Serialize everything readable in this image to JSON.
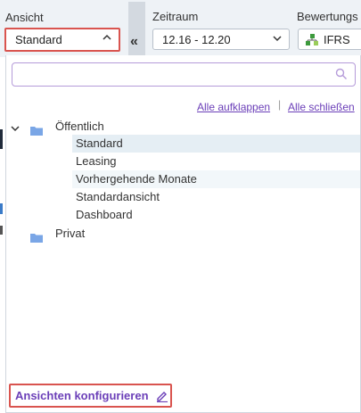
{
  "toolbar": {
    "ansicht_label": "Ansicht",
    "ansicht_value": "Standard",
    "zeitraum_label": "Zeitraum",
    "zeitraum_value": "12.16 - 12.20",
    "bewertung_label": "Bewertungs",
    "bewertung_value": "IFRS",
    "collapse_glyph": "«"
  },
  "panel": {
    "search_placeholder": "",
    "expand_all": "Alle aufklappen",
    "link_separator": "|",
    "collapse_all": "Alle schließen",
    "groups": [
      {
        "label": "Öffentlich",
        "items": [
          "Standard",
          "Leasing",
          "Vorhergehende Monate",
          "Standardansicht",
          "Dashboard"
        ]
      },
      {
        "label": "Privat",
        "items": []
      }
    ],
    "configure_label": "Ansichten konfigurieren"
  },
  "icons": {
    "ansicht_chevron": "chevron-up-icon",
    "zeitraum_chevron": "chevron-down-icon",
    "search": "search-icon",
    "folder": "folder-icon",
    "edit": "pencil-icon"
  },
  "colors": {
    "highlight_border": "#d9544f",
    "accent": "#6b3fb8",
    "folder": "#7aa6e6",
    "selected_row": "#e5eef4"
  }
}
